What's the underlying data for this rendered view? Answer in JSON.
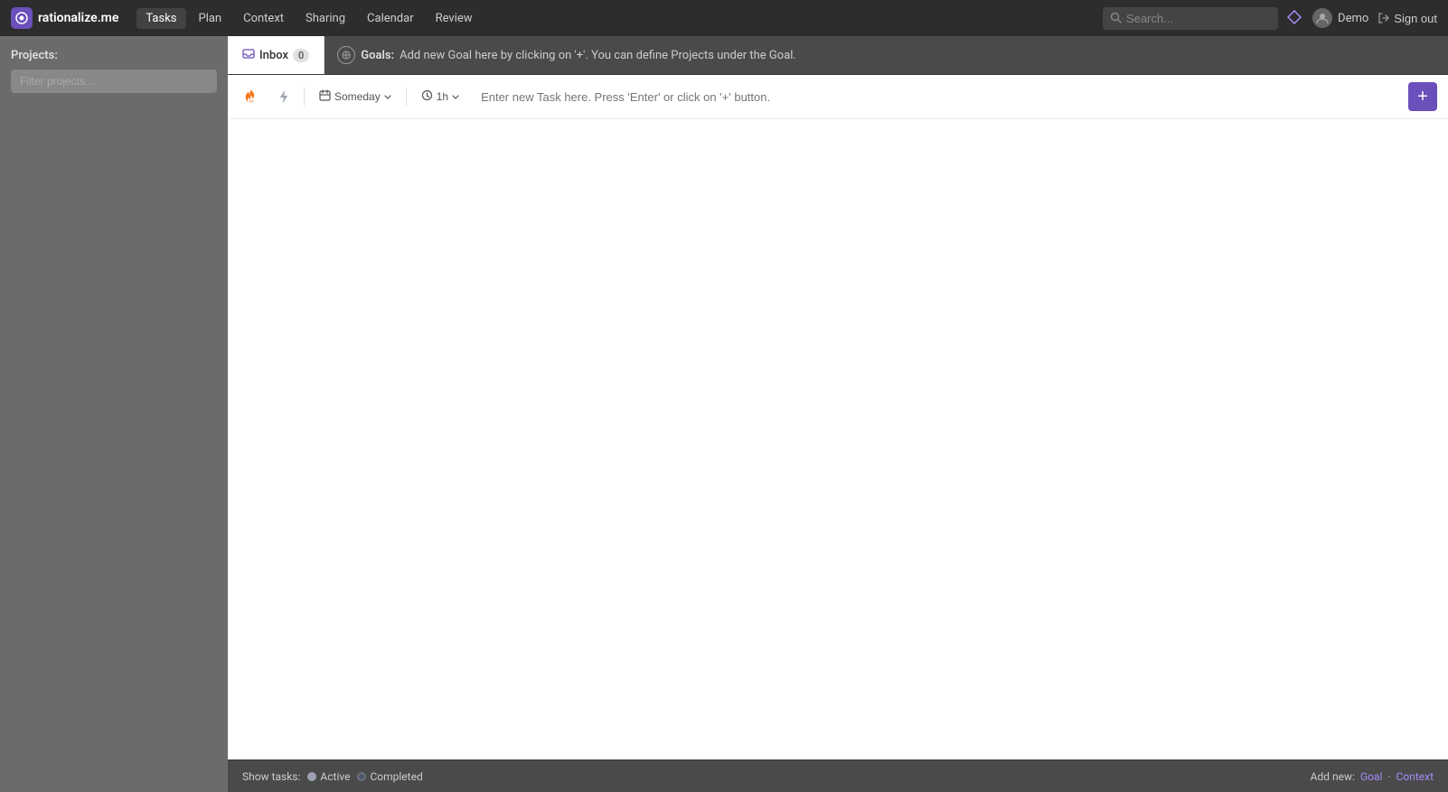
{
  "app": {
    "name": "rationalize.me",
    "logo_text": "rationalize.me"
  },
  "topnav": {
    "items": [
      {
        "label": "Tasks",
        "active": true
      },
      {
        "label": "Plan",
        "active": false
      },
      {
        "label": "Context",
        "active": false
      },
      {
        "label": "Sharing",
        "active": false
      },
      {
        "label": "Calendar",
        "active": false
      },
      {
        "label": "Review",
        "active": false
      }
    ],
    "search_placeholder": "Search...",
    "user_name": "Demo",
    "signout_label": "Sign out"
  },
  "sidebar": {
    "label": "Projects:",
    "filter_placeholder": "Filter projects..."
  },
  "tabs": {
    "inbox_label": "Inbox",
    "inbox_count": "0",
    "goals_label": "Goals:",
    "goals_hint": "Add new Goal here by clicking on '+'. You can define Projects under the Goal."
  },
  "toolbar": {
    "fire_icon": "🔥",
    "bolt_icon": "⚡",
    "someday_label": "Someday",
    "time_label": "1h",
    "task_placeholder": "Enter new Task here. Press 'Enter' or click on '+' button.",
    "add_label": "+"
  },
  "bottom_bar": {
    "show_tasks_label": "Show tasks:",
    "active_label": "Active",
    "completed_label": "Completed",
    "add_new_label": "Add new:",
    "goal_label": "Goal",
    "context_label": "Context"
  }
}
